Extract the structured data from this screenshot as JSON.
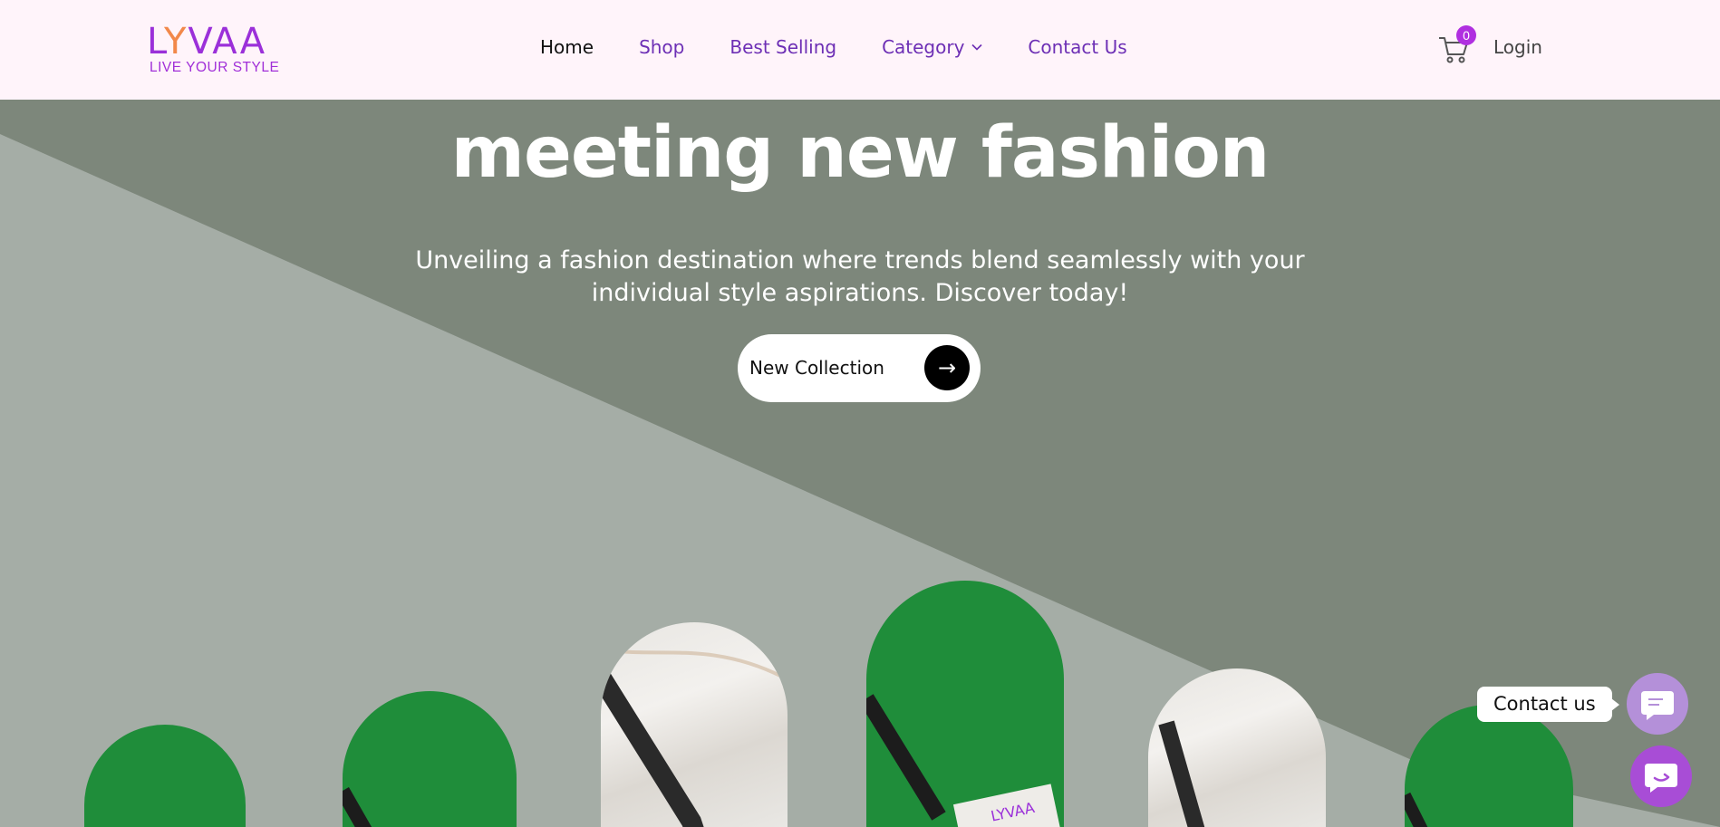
{
  "brand": {
    "logo_text_left": "L",
    "logo_text_y": "Y",
    "logo_text_right": "VAA",
    "tagline": "LIVE YOUR STYLE"
  },
  "nav": {
    "items": [
      {
        "label": "Home"
      },
      {
        "label": "Shop"
      },
      {
        "label": "Best Selling"
      },
      {
        "label": "Category"
      },
      {
        "label": "Contact Us"
      }
    ]
  },
  "cart": {
    "count": "0"
  },
  "account": {
    "login_label": "Login"
  },
  "hero": {
    "title": "meeting new fashion",
    "subtitle_line1": "Unveiling a fashion destination where trends blend seamlessly with your",
    "subtitle_line2": "individual style aspirations. Discover today!",
    "cta_label": "New Collection",
    "cta_arrow": "→"
  },
  "chat": {
    "label": "Contact us"
  },
  "colors": {
    "header_bg": "#fff4fa",
    "nav_link": "#6d2fb5",
    "brand_purple": "#9b30d9",
    "brand_orange": "#f2884a",
    "hero_dark": "#7d877b",
    "hero_light": "#a5ada6",
    "product_green": "#1f8d3a"
  }
}
